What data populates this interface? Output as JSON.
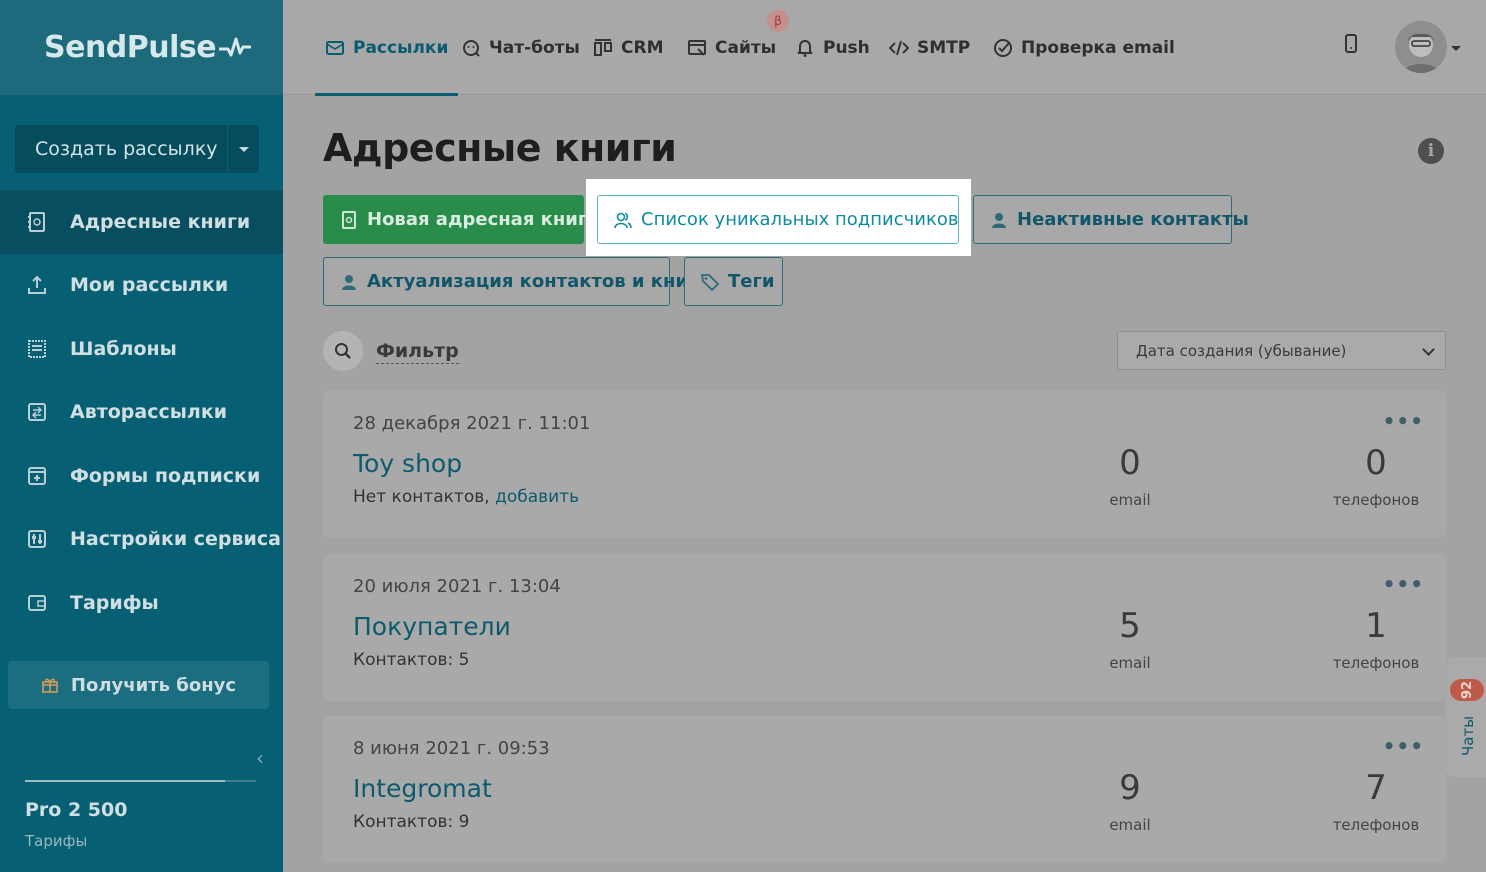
{
  "sidebar": {
    "logo": "SendPulse",
    "create_button": "Создать рассылку",
    "items": [
      {
        "label": "Адресные книги",
        "icon": "address-book-icon",
        "active": true
      },
      {
        "label": "Мои рассылки",
        "icon": "send-icon",
        "active": false
      },
      {
        "label": "Шаблоны",
        "icon": "template-icon",
        "active": false
      },
      {
        "label": "Авторассылки",
        "icon": "automation-icon",
        "active": false
      },
      {
        "label": "Формы подписки",
        "icon": "form-icon",
        "active": false
      },
      {
        "label": "Настройки сервиса",
        "icon": "settings-icon",
        "active": false
      },
      {
        "label": "Тарифы",
        "icon": "wallet-icon",
        "active": false
      }
    ],
    "bonus_button": "Получить бонус",
    "plan_name": "Pro 2 500",
    "plan_link": "Тарифы"
  },
  "topnav": {
    "tabs": [
      {
        "label": "Рассылки",
        "icon": "mail-icon",
        "active": true
      },
      {
        "label": "Чат-боты",
        "icon": "chatbot-icon",
        "active": false
      },
      {
        "label": "CRM",
        "icon": "crm-icon",
        "active": false
      },
      {
        "label": "Сайты",
        "icon": "site-icon",
        "active": false
      },
      {
        "label": "Push",
        "icon": "bell-icon",
        "active": false
      },
      {
        "label": "SMTP",
        "icon": "code-icon",
        "active": false
      },
      {
        "label": "Проверка email",
        "icon": "check-circle-icon",
        "active": false
      }
    ],
    "beta_badge": "β"
  },
  "main": {
    "title": "Адресные книги",
    "buttons": {
      "new_book": "Новая адресная книга",
      "unique_subscribers": "Список уникальных подписчиков",
      "inactive_contacts": "Неактивные контакты",
      "actualization": "Актуализация контактов и книг",
      "tags": "Теги"
    },
    "filter_label": "Фильтр",
    "sort_value": "Дата создания (убывание)",
    "books": [
      {
        "date": "28 декабря 2021 г. 11:01",
        "name": "Toy shop",
        "meta_prefix": "Нет контактов, ",
        "meta_link": "добавить",
        "email_count": "0",
        "email_label": "email",
        "phone_count": "0",
        "phone_label": "телефонов"
      },
      {
        "date": "20 июля 2021 г. 13:04",
        "name": "Покупатели",
        "meta_prefix": "Контактов: 5",
        "meta_link": "",
        "email_count": "5",
        "email_label": "email",
        "phone_count": "1",
        "phone_label": "телефонов"
      },
      {
        "date": "8 июня 2021 г. 09:53",
        "name": "Integromat",
        "meta_prefix": "Контактов: 9",
        "meta_link": "",
        "email_count": "9",
        "email_label": "email",
        "phone_count": "7",
        "phone_label": "телефонов"
      }
    ],
    "more_glyph": "•••"
  },
  "chat_widget": {
    "label": "Чаты",
    "badge": "92"
  },
  "colors": {
    "sidebar": "#075f73",
    "active_item": "#064e60",
    "green_button": "#2a8c4a",
    "accent": "#0a5d70",
    "highlight": "#ffffff",
    "badge": "#bd5a4a"
  }
}
